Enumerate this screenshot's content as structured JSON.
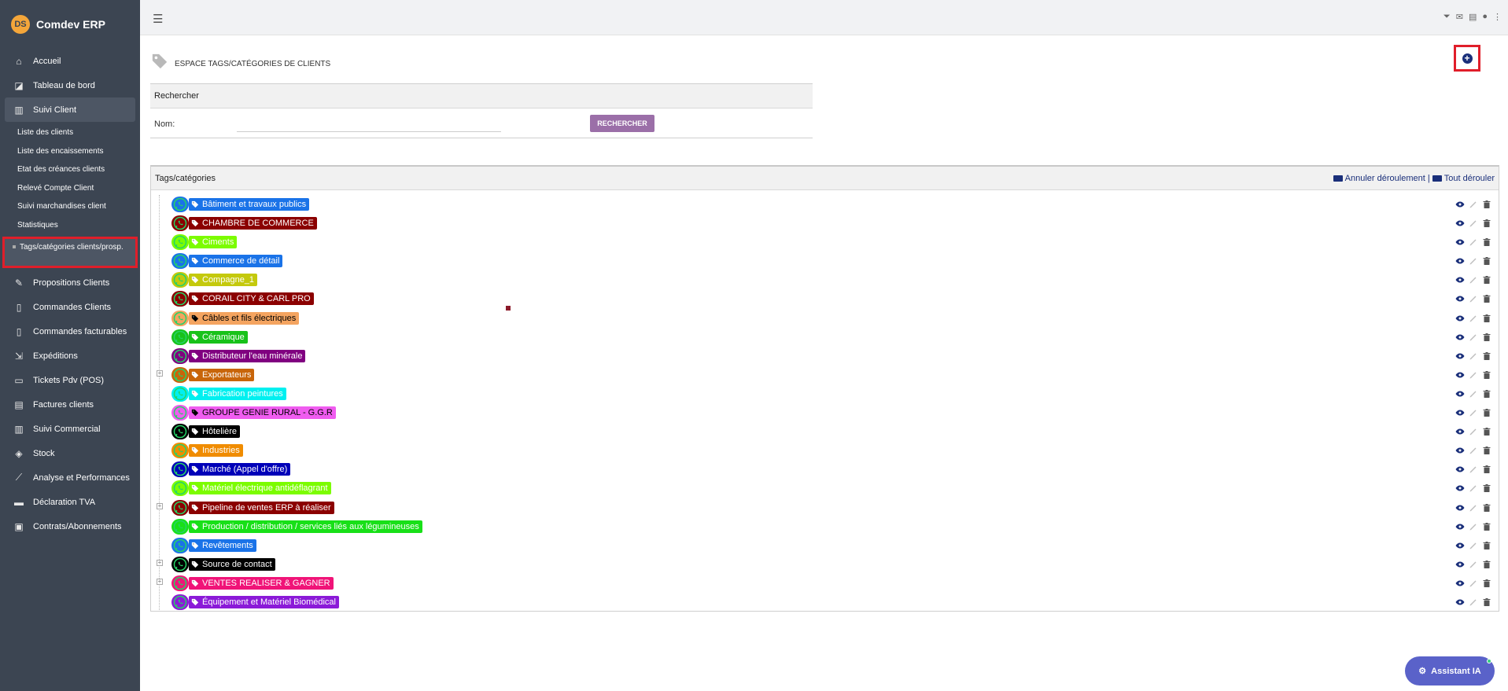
{
  "app": {
    "name": "Comdev ERP",
    "logo_text": "DS"
  },
  "sidebar": {
    "items": [
      {
        "label": "Accueil",
        "icon": "home-icon"
      },
      {
        "label": "Tableau de bord",
        "icon": "chart-icon"
      },
      {
        "label": "Suivi Client",
        "icon": "building-icon"
      }
    ],
    "sub_items": [
      {
        "label": "Liste des clients"
      },
      {
        "label": "Liste des encaissements"
      },
      {
        "label": "Etat des créances clients"
      },
      {
        "label": "Relevé Compte Client"
      },
      {
        "label": "Suivi marchandises client"
      },
      {
        "label": "Statistiques"
      }
    ],
    "selected_sub": "Tags/catégories clients/prosp.",
    "items_after": [
      {
        "label": "Propositions Clients",
        "icon": "proposal-icon"
      },
      {
        "label": "Commandes Clients",
        "icon": "document-icon"
      },
      {
        "label": "Commandes facturables",
        "icon": "document-icon"
      },
      {
        "label": "Expéditions",
        "icon": "dolly-icon"
      },
      {
        "label": "Tickets Pdv (POS)",
        "icon": "receipt-icon"
      },
      {
        "label": "Factures clients",
        "icon": "invoice-icon"
      },
      {
        "label": "Suivi Commercial",
        "icon": "building-icon"
      },
      {
        "label": "Stock",
        "icon": "box-icon"
      },
      {
        "label": "Analyse et Performances",
        "icon": "line-chart-icon"
      },
      {
        "label": "Déclaration TVA",
        "icon": "tax-icon"
      },
      {
        "label": "Contrats/Abonnements",
        "icon": "briefcase-icon"
      }
    ]
  },
  "page": {
    "title": "ESPACE TAGS/CATÉGORIES DE CLIENTS"
  },
  "search": {
    "header": "Rechercher",
    "name_label": "Nom:",
    "name_value": "",
    "button": "RECHERCHER"
  },
  "tags": {
    "header": "Tags/catégories",
    "collapse_label": "Annuler déroulement",
    "separator": "|",
    "expand_label": "Tout dérouler",
    "items": [
      {
        "label": "Bâtiment et travaux publics",
        "color": "#1a73e8",
        "text_color": "#ffffff",
        "expandable": false
      },
      {
        "label": "CHAMBRE DE COMMERCE",
        "color": "#8b0000",
        "text_color": "#ffffff",
        "expandable": false
      },
      {
        "label": "Ciments",
        "color": "#7cfc00",
        "text_color": "#ffffff",
        "expandable": false
      },
      {
        "label": "Commerce de détail",
        "color": "#1a73e8",
        "text_color": "#ffffff",
        "expandable": false
      },
      {
        "label": "Compagne_1",
        "color": "#c4c90c",
        "text_color": "#ffffff",
        "expandable": false
      },
      {
        "label": "CORAIL CITY & CARL PRO",
        "color": "#8b0000",
        "text_color": "#ffffff",
        "expandable": false
      },
      {
        "label": "Câbles et fils électriques",
        "color": "#f4a460",
        "text_color": "#000000",
        "expandable": false
      },
      {
        "label": "Céramique",
        "color": "#18c21a",
        "text_color": "#ffffff",
        "expandable": false
      },
      {
        "label": "Distributeur l'eau minérale",
        "color": "#800080",
        "text_color": "#ffffff",
        "expandable": false
      },
      {
        "label": "Exportateurs",
        "color": "#c8650a",
        "text_color": "#ffffff",
        "expandable": true
      },
      {
        "label": "Fabrication peintures",
        "color": "#00f0f0",
        "text_color": "#ffffff",
        "expandable": false
      },
      {
        "label": "GROUPE GENIE RURAL - G.G.R",
        "color": "#f05cf0",
        "text_color": "#000000",
        "expandable": false
      },
      {
        "label": "Hôtelière",
        "color": "#000000",
        "text_color": "#ffffff",
        "expandable": false
      },
      {
        "label": "Industries",
        "color": "#f08c00",
        "text_color": "#ffffff",
        "expandable": false
      },
      {
        "label": "Marché (Appel d'offre)",
        "color": "#0000b8",
        "text_color": "#ffffff",
        "expandable": false
      },
      {
        "label": "Matériel électrique antidéflagrant",
        "color": "#7cfc00",
        "text_color": "#ffffff",
        "expandable": false
      },
      {
        "label": "Pipeline de ventes ERP à réaliser",
        "color": "#8b0000",
        "text_color": "#ffffff",
        "expandable": true
      },
      {
        "label": "Production / distribution / services liés aux légumineuses",
        "color": "#18e018",
        "text_color": "#ffffff",
        "expandable": false
      },
      {
        "label": "Revêtements",
        "color": "#1a73e8",
        "text_color": "#ffffff",
        "expandable": false
      },
      {
        "label": "Source de contact",
        "color": "#000000",
        "text_color": "#ffffff",
        "expandable": true
      },
      {
        "label": "VENTES REALISER & GAGNER",
        "color": "#f01478",
        "text_color": "#ffffff",
        "expandable": true
      },
      {
        "label": "Équipement et Matériel Biomédical",
        "color": "#8b1ad8",
        "text_color": "#ffffff",
        "expandable": false
      }
    ]
  },
  "assistant": {
    "label": "Assistant IA"
  },
  "colors": {
    "sidebar_bg": "#3c4552",
    "accent": "#1a2f7a",
    "search_btn": "#9b6fa8",
    "highlight": "#e01e2a",
    "whatsapp": "#25d366"
  }
}
